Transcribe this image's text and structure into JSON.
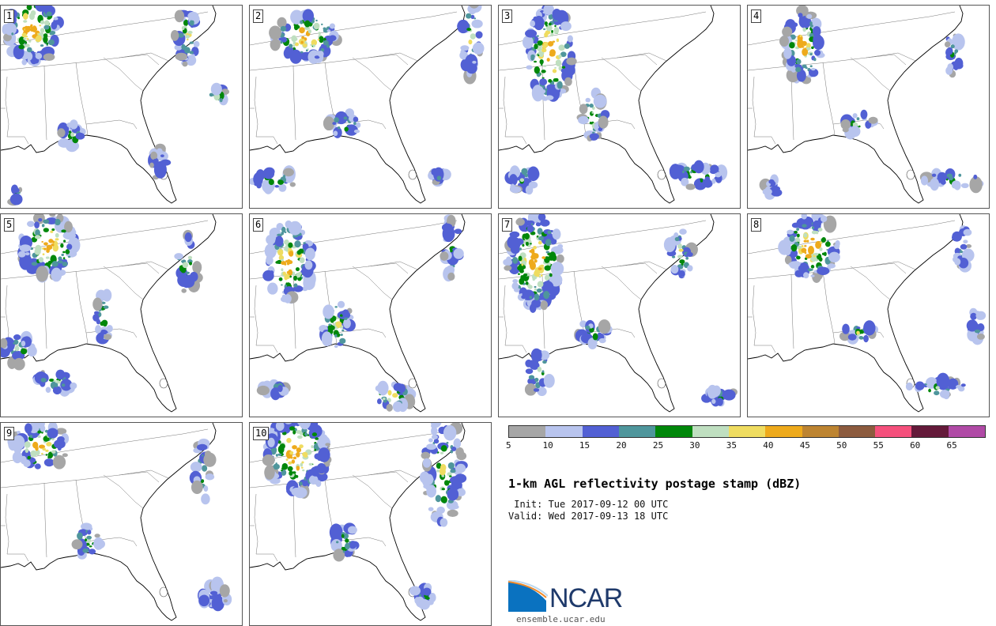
{
  "panels": [
    {
      "label": "1"
    },
    {
      "label": "2"
    },
    {
      "label": "3"
    },
    {
      "label": "4"
    },
    {
      "label": "5"
    },
    {
      "label": "6"
    },
    {
      "label": "7"
    },
    {
      "label": "8"
    },
    {
      "label": "9"
    },
    {
      "label": "10"
    }
  ],
  "colorbar": {
    "colors": [
      "#a6a6a6",
      "#b8c4ee",
      "#5260d4",
      "#4f969c",
      "#00870a",
      "#bfdfc0",
      "#efdc60",
      "#eeaa1c",
      "#bd8431",
      "#8c5b3e",
      "#f5507c",
      "#641a3a",
      "#b04aa6"
    ],
    "ticks": [
      "5",
      "10",
      "15",
      "20",
      "25",
      "30",
      "35",
      "40",
      "45",
      "50",
      "55",
      "60",
      "65"
    ]
  },
  "title": "1-km AGL reflectivity postage stamp (dBZ)",
  "init": " Init: Tue 2017-09-12 00 UTC",
  "valid": "Valid: Wed 2017-09-13 18 UTC",
  "logo": {
    "text": "NCAR",
    "url": "ensemble.ucar.edu"
  }
}
